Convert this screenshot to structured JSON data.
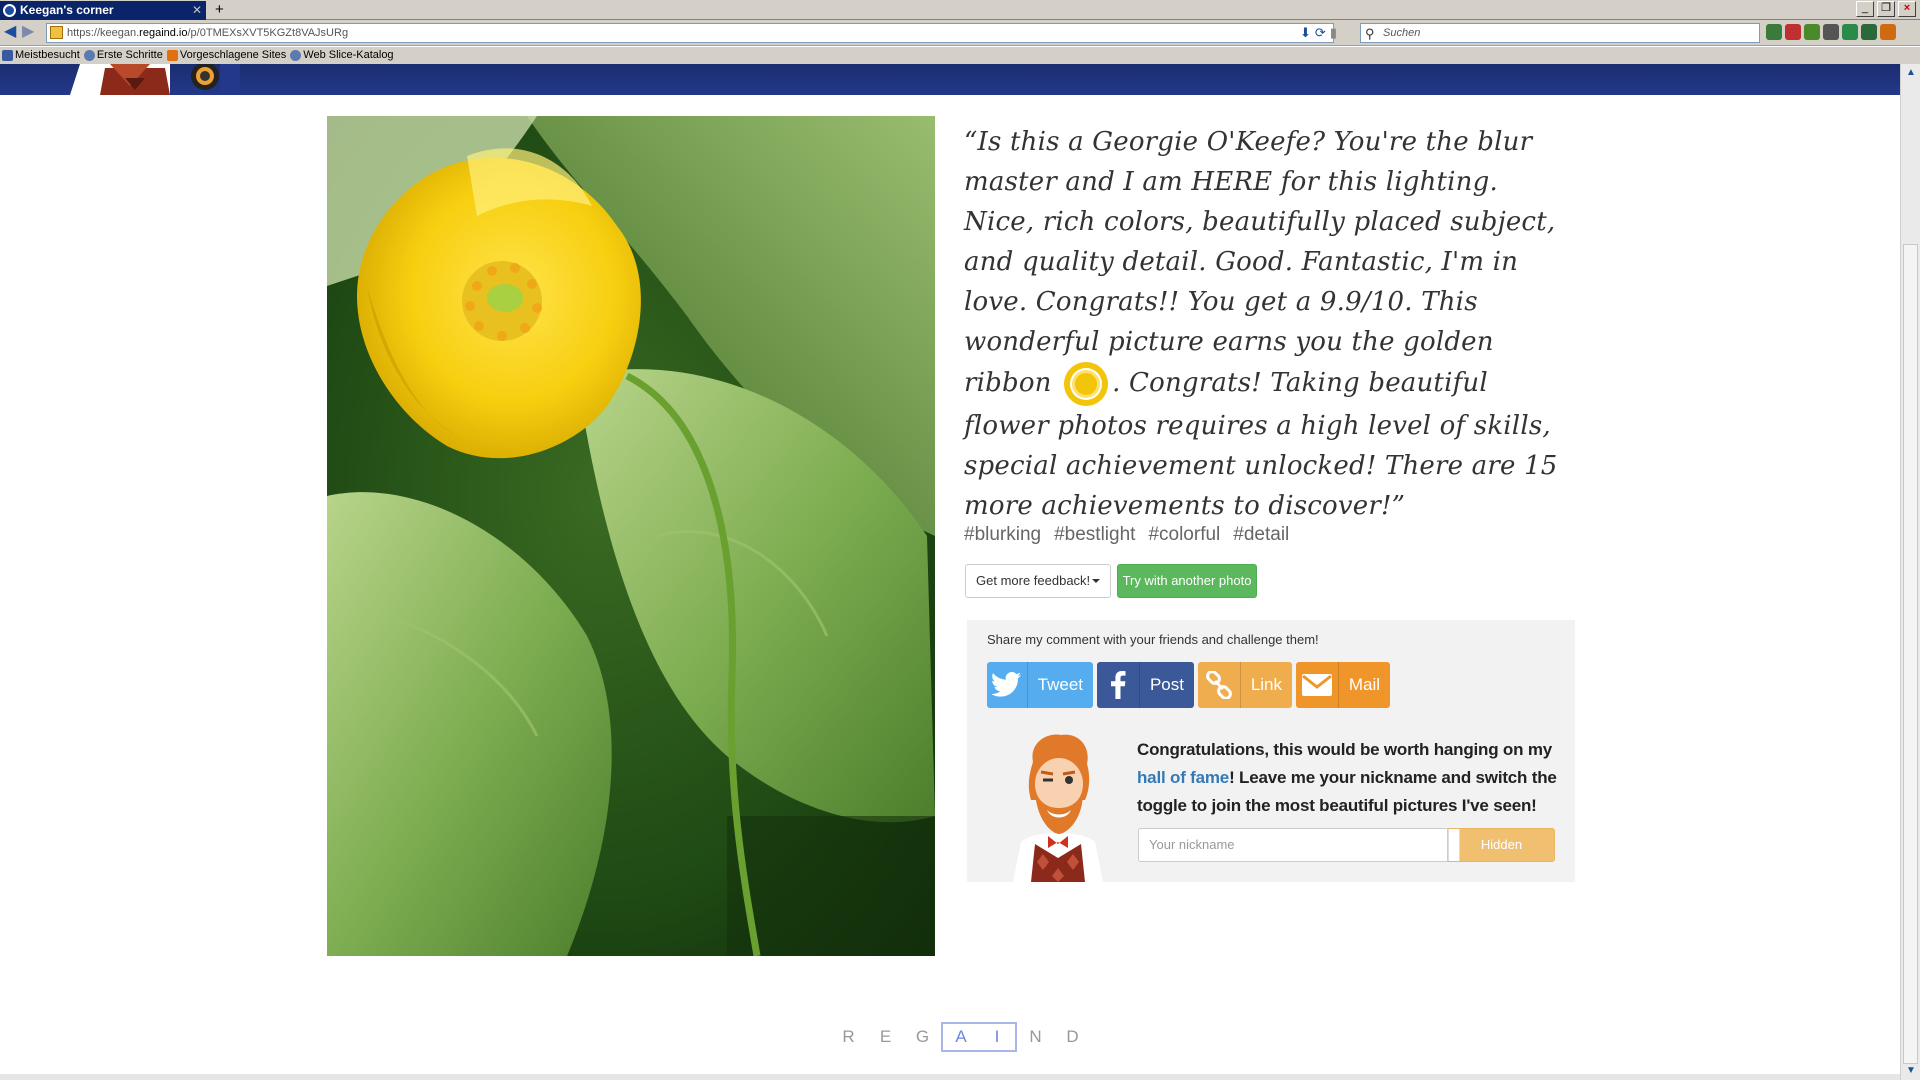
{
  "browser": {
    "tab_title": "Keegan's corner",
    "tab_close": "✕",
    "new_tab": "+",
    "url_prefix": "https://keegan.",
    "url_host": "regaind.io",
    "url_path": "/p/0TMEXsXVT5KGZt8VAJsURg",
    "search_placeholder": "Suchen",
    "bookmarks": [
      "Meistbesucht",
      "Erste Schritte",
      "Vorgeschlagene Sites",
      "Web Slice-Katalog"
    ]
  },
  "comment": {
    "open_quote": "“",
    "part1": "Is this a Georgie O'Keefe? You're the blur master and I am HERE for this lighting. Nice, rich colors, beautifully placed subject, and quality detail. Good. Fantastic, I'm in love. Congrats!! You get a 9.9/10. This wonderful picture earns you the golden ribbon",
    "part2": ". Congrats! Taking beautiful flower photos requires a high level of skills, special achievement unlocked! There are 15 more achievements to discover!",
    "close_quote": "”"
  },
  "tags": [
    "#blurking",
    "#bestlight",
    "#colorful",
    "#detail"
  ],
  "actions": {
    "feedback_label": "Get more feedback!",
    "try_label": "Try with another photo"
  },
  "share": {
    "title": "Share my comment with your friends and challenge them!",
    "tweet": "Tweet",
    "post": "Post",
    "link": "Link",
    "mail": "Mail"
  },
  "hall_of_fame": {
    "text_before": "Congratulations, this would be worth hanging on my ",
    "link_text": "hall of fame",
    "text_after": "! Leave me your nickname and switch the toggle to join the most beautiful pictures I've seen!",
    "nickname_placeholder": "Your nickname",
    "toggle_label": "Hidden"
  },
  "logo": {
    "before": [
      "R",
      "E",
      "G"
    ],
    "boxed": [
      "A",
      "I"
    ],
    "after": [
      "N",
      "D"
    ]
  },
  "colors": {
    "header_band": "#1b2d70",
    "try_button": "#5cb85c",
    "twitter": "#55acee",
    "facebook": "#3b5998",
    "link": "#f0ad4e",
    "mail": "#f0952a",
    "toggle": "#f0c070",
    "hall_link": "#337ab7"
  }
}
